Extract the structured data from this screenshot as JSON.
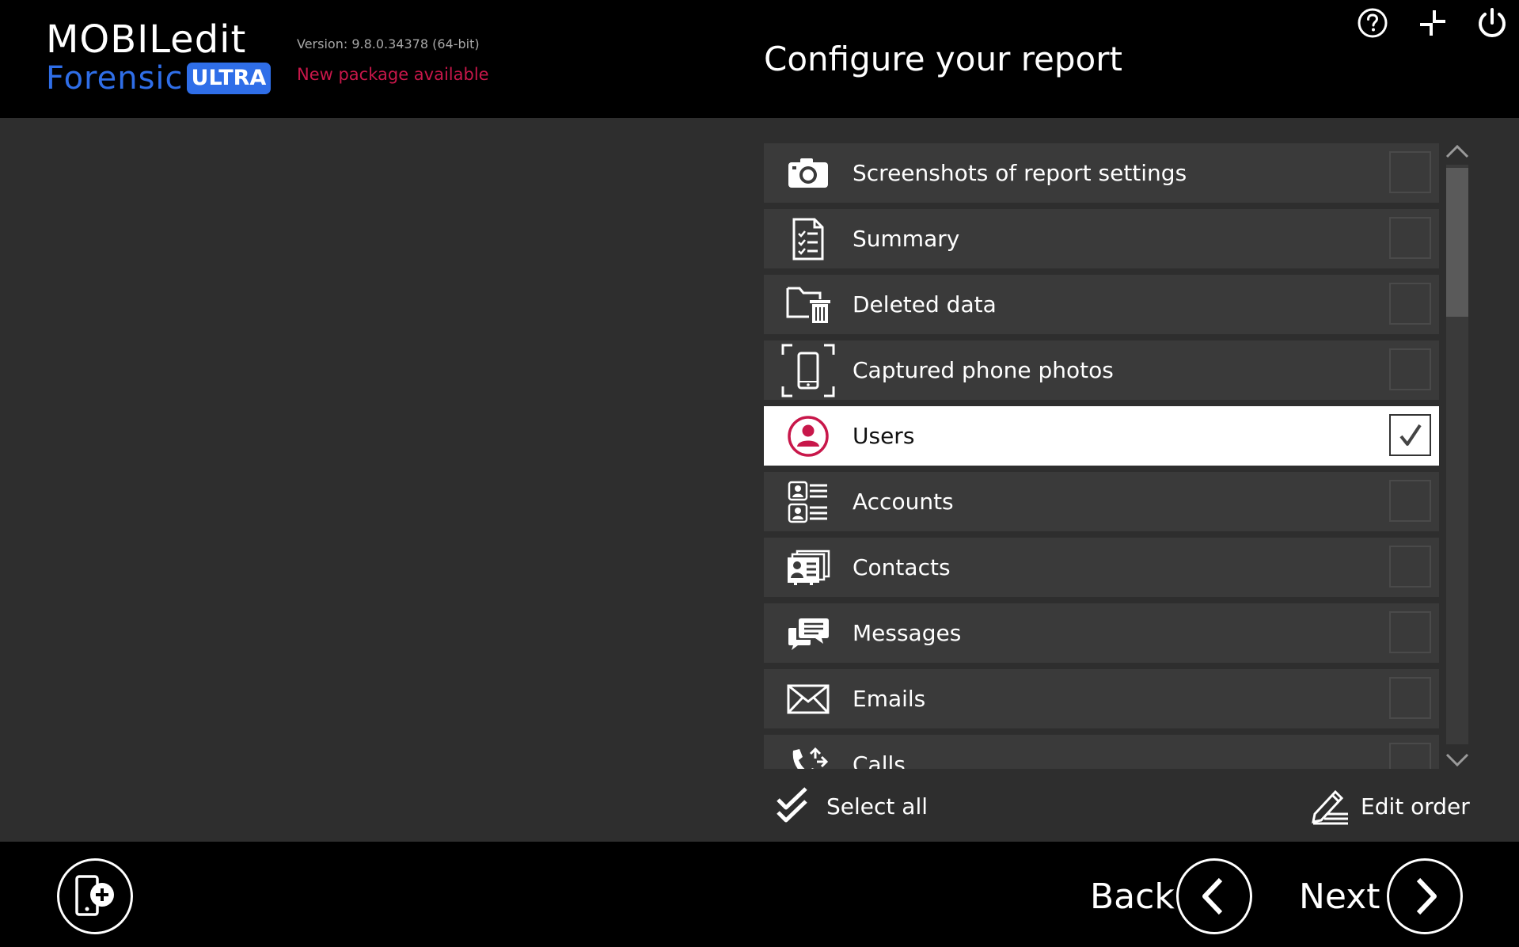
{
  "app": {
    "logo_line1": "MOBILedit",
    "logo_line2": "Forensic",
    "logo_badge": "ULTRA",
    "version": "Version: 9.8.0.34378 (64-bit)",
    "new_package": "New package available"
  },
  "header": {
    "title": "Configure your report",
    "icons": [
      "help-icon",
      "collapse-icon",
      "power-icon"
    ]
  },
  "report_sections": [
    {
      "label": "Screenshots of report settings",
      "icon": "camera-icon",
      "checked": false
    },
    {
      "label": "Summary",
      "icon": "summary-document-icon",
      "checked": false
    },
    {
      "label": "Deleted data",
      "icon": "deleted-data-icon",
      "checked": false
    },
    {
      "label": "Captured phone photos",
      "icon": "phone-capture-icon",
      "checked": false
    },
    {
      "label": "Users",
      "icon": "user-icon",
      "checked": true
    },
    {
      "label": "Accounts",
      "icon": "accounts-icon",
      "checked": false
    },
    {
      "label": "Contacts",
      "icon": "contacts-icon",
      "checked": false
    },
    {
      "label": "Messages",
      "icon": "messages-icon",
      "checked": false
    },
    {
      "label": "Emails",
      "icon": "email-icon",
      "checked": false
    },
    {
      "label": "Calls",
      "icon": "calls-icon",
      "checked": false
    }
  ],
  "actions": {
    "select_all": "Select all",
    "edit_order": "Edit order"
  },
  "footer": {
    "back": "Back",
    "next": "Next"
  },
  "colors": {
    "accent_red": "#c8174a",
    "brand_blue": "#2f6ee8",
    "checkbox_border": "#4a4a4a"
  }
}
